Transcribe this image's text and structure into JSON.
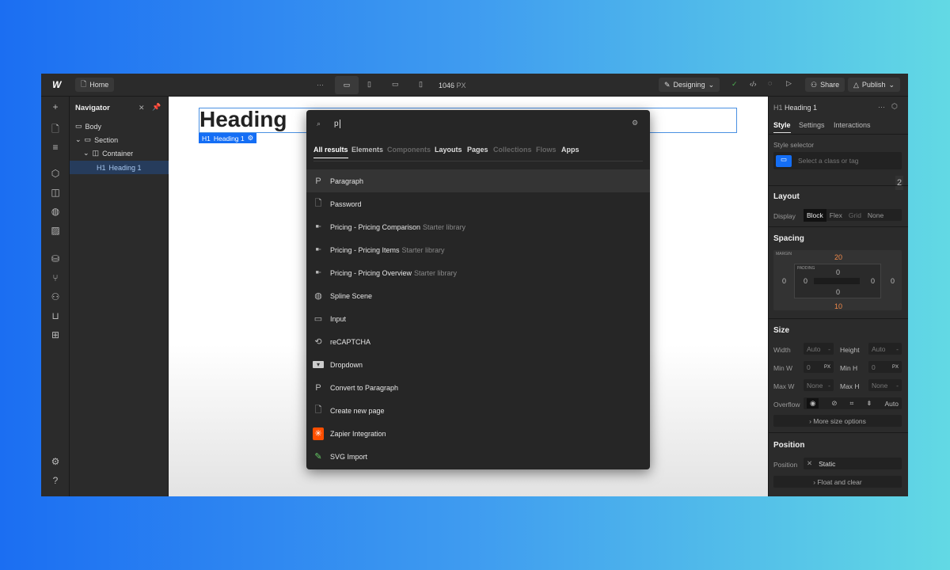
{
  "topbar": {
    "logo": "W",
    "page": "Home",
    "more": "···",
    "width": "1046",
    "unit": "PX",
    "mode": "Designing",
    "share": "Share",
    "publish": "Publish"
  },
  "navigator": {
    "title": "Navigator",
    "items": [
      {
        "label": "Body",
        "icon": "body-icon"
      },
      {
        "label": "Section",
        "icon": "section-icon"
      },
      {
        "label": "Container",
        "icon": "container-icon"
      },
      {
        "tag": "H1",
        "label": "Heading 1"
      }
    ]
  },
  "canvas": {
    "heading": "Heading",
    "badge_tag": "H1",
    "badge_label": "Heading 1"
  },
  "palette": {
    "query": "p",
    "tabs": [
      {
        "label": "All results",
        "active": true
      },
      {
        "label": "Elements"
      },
      {
        "label": "Components",
        "dim": true
      },
      {
        "label": "Layouts"
      },
      {
        "label": "Pages"
      },
      {
        "label": "Collections",
        "dim": true
      },
      {
        "label": "Flows",
        "dim": true
      },
      {
        "label": "Apps"
      }
    ],
    "results": [
      {
        "label": "Paragraph",
        "icon": "P"
      },
      {
        "label": "Password",
        "icon": "file"
      },
      {
        "label": "Pricing - Pricing Comparison",
        "sub": "Starter library",
        "icon": "layout"
      },
      {
        "label": "Pricing - Pricing Items",
        "sub": "Starter library",
        "icon": "layout"
      },
      {
        "label": "Pricing - Pricing Overview",
        "sub": "Starter library",
        "icon": "layout"
      },
      {
        "label": "Spline Scene",
        "icon": "globe"
      },
      {
        "label": "Input",
        "icon": "input"
      },
      {
        "label": "reCAPTCHA",
        "icon": "recaptcha"
      },
      {
        "label": "Dropdown",
        "icon": "dropdown"
      },
      {
        "label": "Convert to Paragraph",
        "icon": "P"
      },
      {
        "label": "Create new page",
        "icon": "new-page"
      },
      {
        "label": "Zapier Integration",
        "icon": "zapier"
      },
      {
        "label": "SVG Import",
        "icon": "svg"
      }
    ]
  },
  "panel": {
    "element_tag": "H1",
    "element": "Heading 1",
    "tabs": [
      "Style",
      "Settings",
      "Interactions"
    ],
    "style_selector_label": "Style selector",
    "style_selector_placeholder": "Select a class or tag",
    "badge_number": "2",
    "layout": {
      "title": "Layout",
      "display_label": "Display",
      "options": [
        "Block",
        "Flex",
        "Grid",
        "None"
      ],
      "selected": "Block"
    },
    "spacing": {
      "title": "Spacing",
      "margin_label": "MARGIN",
      "padding_label": "PADDING",
      "margin": {
        "top": "20",
        "right": "0",
        "bottom": "10",
        "left": "0"
      },
      "padding": {
        "top": "0",
        "right": "0",
        "bottom": "0",
        "left": "0"
      }
    },
    "size": {
      "title": "Size",
      "width_label": "Width",
      "width": "Auto",
      "height_label": "Height",
      "height": "Auto",
      "minw_label": "Min W",
      "minw": "0",
      "minh_label": "Min H",
      "minh": "0",
      "unit": "PX",
      "maxw_label": "Max W",
      "maxw": "None",
      "maxh_label": "Max H",
      "maxh": "None",
      "overflow_label": "Overflow",
      "overflow_auto": "Auto",
      "more": "More size options"
    },
    "position": {
      "title": "Position",
      "label": "Position",
      "value": "Static",
      "float": "Float and clear"
    }
  },
  "colors": {
    "accent": "#146ef5",
    "margin_value": "#f0894a"
  }
}
